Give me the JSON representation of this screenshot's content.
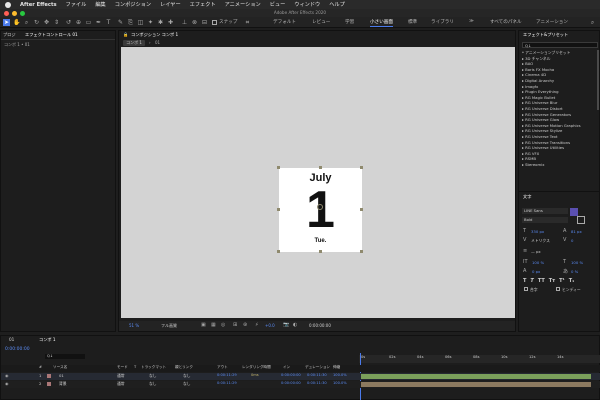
{
  "menubar": {
    "app": "After Effects",
    "items": [
      "ファイル",
      "編集",
      "コンポジション",
      "レイヤー",
      "エフェクト",
      "アニメーション",
      "ビュー",
      "ウィンドウ",
      "ヘルプ"
    ]
  },
  "window_title": "Adobe After Effects 2020",
  "toolbar": {
    "snap_label": "スナップ",
    "workspaces": [
      "デフォルト",
      "レビュー",
      "学習",
      "小さい画面",
      "標準",
      "ライブラリ",
      "≫",
      "すべてのパネル",
      "アニメーション"
    ],
    "active_workspace": "小さい画面"
  },
  "left_panel": {
    "tab1": "プロジ",
    "tab2": "エフェクトコントロール 01",
    "subtitle": "コンポ 1 • 01"
  },
  "comp_panel": {
    "tab": "コンポジション コンポ 1",
    "breadcrumb_1": "コンポ 1",
    "breadcrumb_2": "01",
    "zoom": "51 %",
    "quality": "フル画質",
    "exposure": "+0.0",
    "timecode": "0:00:00:00"
  },
  "card": {
    "month": "July",
    "day": "1",
    "weekday": "Tue."
  },
  "effects_panel": {
    "title": "エフェクト&プリセット",
    "search_value": "Q↓",
    "items": [
      "* アニメーションプリセット",
      "3D チャンネル",
      "BAO",
      "Boris FX Mocha",
      "Cinema 4D",
      "Digital Anarchy",
      "Imagfx",
      "Plugin Everything",
      "RG Magic Bullet",
      "RG Universe Blur",
      "RG Universe Distort",
      "RG Universe Generators",
      "RG Universe Glow",
      "RG Universe Motion Graphics",
      "RG Universe Stylize",
      "RG Universe Text",
      "RG Universe Transitions",
      "RG Universe Utilities",
      "RG VFX",
      "RSMB",
      "Stereomix"
    ]
  },
  "text_panel": {
    "title": "文字",
    "font": "LINE Sans",
    "style": "Bold",
    "size": "330 px",
    "leading": "81 px",
    "metrics": "メトリクス",
    "tracking": "0",
    "stroke": "— px",
    "vscale": "100 %",
    "hscale": "100 %",
    "baseline": "0 px",
    "tsume": "0 %",
    "ligature": "合字",
    "hindi": "ヒンディー"
  },
  "timeline": {
    "tab1": "01",
    "tab2": "コンポ 1",
    "timecode": "0:00:00:00",
    "search_placeholder": "Q↓",
    "columns": [
      "#",
      "ソース名",
      "モード",
      "T",
      "トラックマット",
      "親とリンク",
      "アウト",
      "レンダリング時間",
      "イン",
      "デュレーション",
      "伸縮"
    ],
    "ruler": [
      "0s",
      "02s",
      "04s",
      "06s",
      "08s",
      "10s",
      "12s",
      "14s"
    ],
    "layers": [
      {
        "num": "1",
        "name": "01",
        "mode": "通常",
        "matte": "なし",
        "parent": "なし",
        "out": "0:00:11:29",
        "render": "0ms",
        "in": "0:00:00:00",
        "duration": "0:00:11:30",
        "stretch": "100.0%"
      },
      {
        "num": "2",
        "name": "背景",
        "mode": "通常",
        "matte": "なし",
        "parent": "なし",
        "out": "0:00:11:29",
        "render": "",
        "in": "0:00:00:00",
        "duration": "0:00:11:30",
        "stretch": "100.0%"
      }
    ]
  },
  "colors": {
    "accent": "#4b7bec",
    "timecode": "#5b8cf5",
    "track_green": "#7ba05b",
    "track_tan": "#8c7a60"
  }
}
